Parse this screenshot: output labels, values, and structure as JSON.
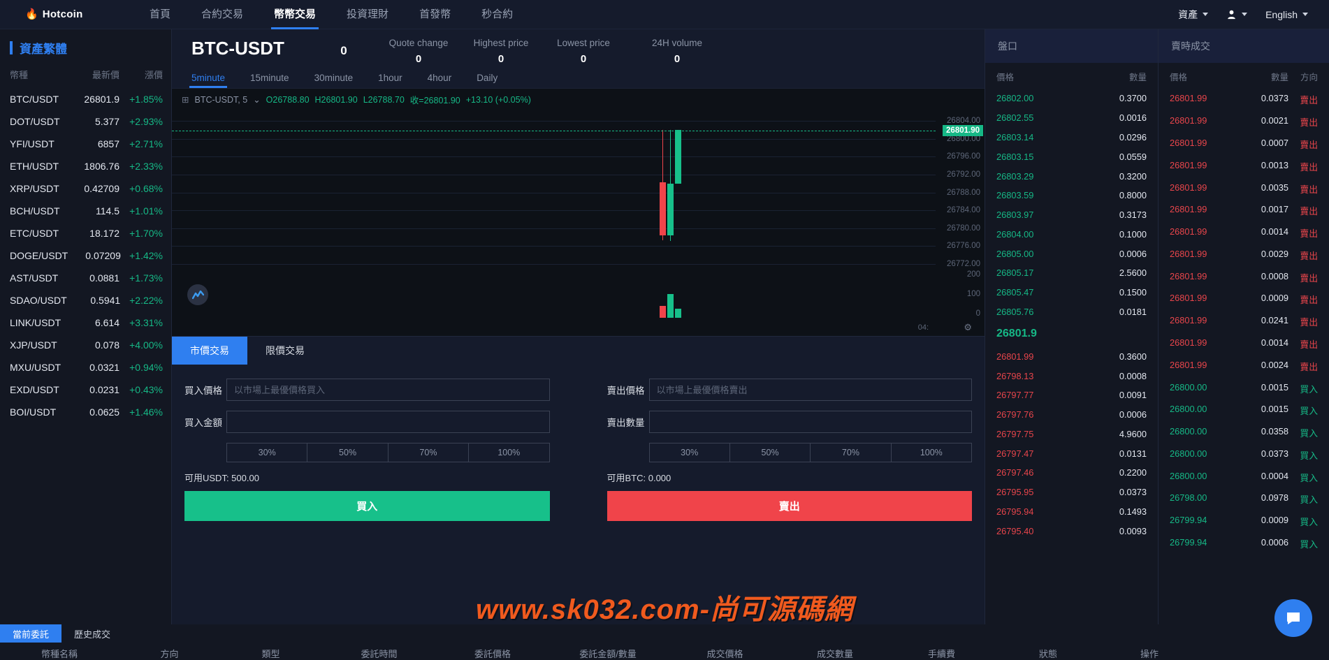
{
  "header": {
    "brand": "Hotcoin",
    "brand_icon": "flame-icon",
    "nav": [
      {
        "label": "首頁",
        "active": false
      },
      {
        "label": "合約交易",
        "active": false
      },
      {
        "label": "幣幣交易",
        "active": true
      },
      {
        "label": "投資理財",
        "active": false
      },
      {
        "label": "首發幣",
        "active": false
      },
      {
        "label": "秒合約",
        "active": false
      }
    ],
    "assets_label": "資產",
    "language_label": "English"
  },
  "sidebar": {
    "title": "資產繁體",
    "columns": [
      "幣種",
      "最新價",
      "漲價"
    ],
    "coins": [
      {
        "pair": "BTC/USDT",
        "price": "26801.9",
        "change": "+1.85%"
      },
      {
        "pair": "DOT/USDT",
        "price": "5.377",
        "change": "+2.93%"
      },
      {
        "pair": "YFI/USDT",
        "price": "6857",
        "change": "+2.71%"
      },
      {
        "pair": "ETH/USDT",
        "price": "1806.76",
        "change": "+2.33%"
      },
      {
        "pair": "XRP/USDT",
        "price": "0.42709",
        "change": "+0.68%"
      },
      {
        "pair": "BCH/USDT",
        "price": "114.5",
        "change": "+1.01%"
      },
      {
        "pair": "ETC/USDT",
        "price": "18.172",
        "change": "+1.70%"
      },
      {
        "pair": "DOGE/USDT",
        "price": "0.07209",
        "change": "+1.42%"
      },
      {
        "pair": "AST/USDT",
        "price": "0.0881",
        "change": "+1.73%"
      },
      {
        "pair": "SDAO/USDT",
        "price": "0.5941",
        "change": "+2.22%"
      },
      {
        "pair": "LINK/USDT",
        "price": "6.614",
        "change": "+3.31%"
      },
      {
        "pair": "XJP/USDT",
        "price": "0.078",
        "change": "+4.00%"
      },
      {
        "pair": "MXU/USDT",
        "price": "0.0321",
        "change": "+0.94%"
      },
      {
        "pair": "EXD/USDT",
        "price": "0.0231",
        "change": "+0.43%"
      },
      {
        "pair": "BOI/USDT",
        "price": "0.0625",
        "change": "+1.46%"
      }
    ]
  },
  "ticker": {
    "pair": "BTC-USDT",
    "price": "0",
    "stats": [
      {
        "label": "Quote change",
        "value": "0"
      },
      {
        "label": "Highest price",
        "value": "0"
      },
      {
        "label": "Lowest price",
        "value": "0"
      },
      {
        "label": "24H volume",
        "value": "0"
      }
    ],
    "timeframes": [
      {
        "label": "5minute",
        "active": true
      },
      {
        "label": "15minute",
        "active": false
      },
      {
        "label": "30minute",
        "active": false
      },
      {
        "label": "1hour",
        "active": false
      },
      {
        "label": "4hour",
        "active": false
      },
      {
        "label": "Daily",
        "active": false
      }
    ]
  },
  "chart_data": {
    "type": "line",
    "title": "BTC-USDT, 5",
    "symbol_label": "BTC-USDT, 5",
    "ohlc": {
      "open": "O26788.80",
      "high": "H26801.90",
      "low": "L26788.70",
      "close": "收=26801.90",
      "change": "+13.10 (+0.05%)"
    },
    "xlabel": "",
    "ylabel": "",
    "ylim": [
      26770,
      26806
    ],
    "yticks": [
      "26804.00",
      "26800.00",
      "26796.00",
      "26792.00",
      "26788.00",
      "26784.00",
      "26780.00",
      "26776.00",
      "26772.00"
    ],
    "current_price_badge": "26801.90",
    "volume_ticks": [
      "200",
      "100",
      "0"
    ],
    "time_label": "04:",
    "candles": [
      {
        "open": 26788.8,
        "high": 26801.9,
        "low": 26774.2,
        "close": 26775.5,
        "dir": "down",
        "volume": 60
      },
      {
        "open": 26775.5,
        "high": 26801.9,
        "low": 26774.0,
        "close": 26788.5,
        "dir": "up",
        "volume": 120
      },
      {
        "open": 26788.5,
        "high": 26801.9,
        "low": 26795.0,
        "close": 26801.9,
        "dir": "up",
        "volume": 45
      }
    ]
  },
  "trade_form": {
    "tabs": [
      {
        "label": "市價交易",
        "active": true
      },
      {
        "label": "限價交易",
        "active": false
      }
    ],
    "buy": {
      "price_label": "買入價格",
      "price_placeholder": "以市場上最優價格買入",
      "price_value": "",
      "amount_label": "買入金額",
      "amount_placeholder": "",
      "amount_value": "",
      "percents": [
        "30%",
        "50%",
        "70%",
        "100%"
      ],
      "available": "可用USDT: 500.00",
      "submit": "買入"
    },
    "sell": {
      "price_label": "賣出價格",
      "price_placeholder": "以市場上最優價格賣出",
      "price_value": "",
      "amount_label": "賣出數量",
      "amount_placeholder": "",
      "amount_value": "",
      "percents": [
        "30%",
        "50%",
        "70%",
        "100%"
      ],
      "available": "可用BTC: 0.000",
      "submit": "賣出"
    }
  },
  "orderbook": {
    "title": "盤口",
    "columns": [
      "價格",
      "數量"
    ],
    "asks": [
      {
        "price": "26802.00",
        "qty": "0.3700"
      },
      {
        "price": "26802.55",
        "qty": "0.0016"
      },
      {
        "price": "26803.14",
        "qty": "0.0296"
      },
      {
        "price": "26803.15",
        "qty": "0.0559"
      },
      {
        "price": "26803.29",
        "qty": "0.3200"
      },
      {
        "price": "26803.59",
        "qty": "0.8000"
      },
      {
        "price": "26803.97",
        "qty": "0.3173"
      },
      {
        "price": "26804.00",
        "qty": "0.1000"
      },
      {
        "price": "26805.00",
        "qty": "0.0006"
      },
      {
        "price": "26805.17",
        "qty": "2.5600"
      },
      {
        "price": "26805.47",
        "qty": "0.1500"
      },
      {
        "price": "26805.76",
        "qty": "0.0181"
      }
    ],
    "mid_price": "26801.9",
    "bids": [
      {
        "price": "26801.99",
        "qty": "0.3600"
      },
      {
        "price": "26798.13",
        "qty": "0.0008"
      },
      {
        "price": "26797.77",
        "qty": "0.0091"
      },
      {
        "price": "26797.76",
        "qty": "0.0006"
      },
      {
        "price": "26797.75",
        "qty": "4.9600"
      },
      {
        "price": "26797.47",
        "qty": "0.0131"
      },
      {
        "price": "26797.46",
        "qty": "0.2200"
      },
      {
        "price": "26795.95",
        "qty": "0.0373"
      },
      {
        "price": "26795.94",
        "qty": "0.1493"
      },
      {
        "price": "26795.40",
        "qty": "0.0093"
      }
    ]
  },
  "realtime_trades": {
    "title": "賣時成交",
    "columns": [
      "價格",
      "數量",
      "方向"
    ],
    "rows": [
      {
        "price": "26801.99",
        "qty": "0.0373",
        "dir": "賣出",
        "side": "sell"
      },
      {
        "price": "26801.99",
        "qty": "0.0021",
        "dir": "賣出",
        "side": "sell"
      },
      {
        "price": "26801.99",
        "qty": "0.0007",
        "dir": "賣出",
        "side": "sell"
      },
      {
        "price": "26801.99",
        "qty": "0.0013",
        "dir": "賣出",
        "side": "sell"
      },
      {
        "price": "26801.99",
        "qty": "0.0035",
        "dir": "賣出",
        "side": "sell"
      },
      {
        "price": "26801.99",
        "qty": "0.0017",
        "dir": "賣出",
        "side": "sell"
      },
      {
        "price": "26801.99",
        "qty": "0.0014",
        "dir": "賣出",
        "side": "sell"
      },
      {
        "price": "26801.99",
        "qty": "0.0029",
        "dir": "賣出",
        "side": "sell"
      },
      {
        "price": "26801.99",
        "qty": "0.0008",
        "dir": "賣出",
        "side": "sell"
      },
      {
        "price": "26801.99",
        "qty": "0.0009",
        "dir": "賣出",
        "side": "sell"
      },
      {
        "price": "26801.99",
        "qty": "0.0241",
        "dir": "賣出",
        "side": "sell"
      },
      {
        "price": "26801.99",
        "qty": "0.0014",
        "dir": "賣出",
        "side": "sell"
      },
      {
        "price": "26801.99",
        "qty": "0.0024",
        "dir": "賣出",
        "side": "sell"
      },
      {
        "price": "26800.00",
        "qty": "0.0015",
        "dir": "買入",
        "side": "buy"
      },
      {
        "price": "26800.00",
        "qty": "0.0015",
        "dir": "買入",
        "side": "buy"
      },
      {
        "price": "26800.00",
        "qty": "0.0358",
        "dir": "買入",
        "side": "buy"
      },
      {
        "price": "26800.00",
        "qty": "0.0373",
        "dir": "買入",
        "side": "buy"
      },
      {
        "price": "26800.00",
        "qty": "0.0004",
        "dir": "買入",
        "side": "buy"
      },
      {
        "price": "26798.00",
        "qty": "0.0978",
        "dir": "買入",
        "side": "buy"
      },
      {
        "price": "26799.94",
        "qty": "0.0009",
        "dir": "買入",
        "side": "buy"
      },
      {
        "price": "26799.94",
        "qty": "0.0006",
        "dir": "買入",
        "side": "buy"
      }
    ]
  },
  "bottom": {
    "tabs": [
      {
        "label": "當前委託",
        "active": true
      },
      {
        "label": "歷史成交",
        "active": false
      }
    ],
    "columns": [
      "幣種名稱",
      "方向",
      "類型",
      "委託時間",
      "委託價格",
      "委託金額/數量",
      "成交價格",
      "成交數量",
      "手續費",
      "狀態",
      "操作"
    ]
  },
  "watermark": "www.sk032.com-尚可源碼網"
}
